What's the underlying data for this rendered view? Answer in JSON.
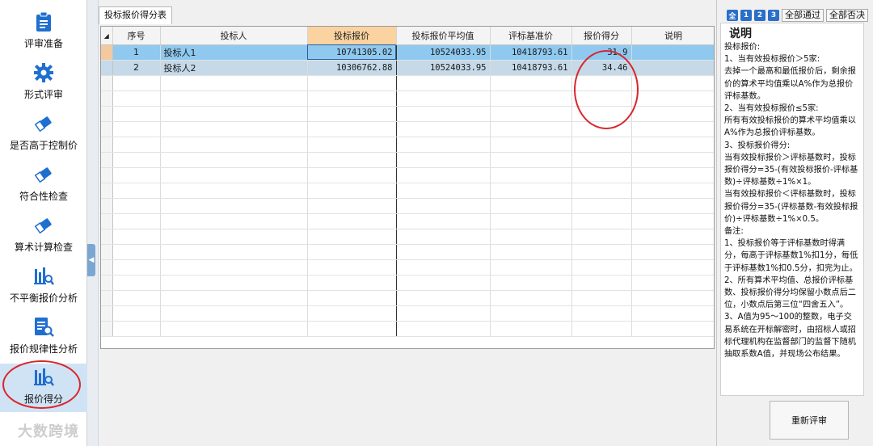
{
  "sidebar": {
    "items": [
      {
        "label": "评审准备",
        "icon": "clipboard-icon"
      },
      {
        "label": "形式评审",
        "icon": "gear-icon"
      },
      {
        "label": "是否高于控制价",
        "icon": "eraser-icon"
      },
      {
        "label": "符合性检查",
        "icon": "eraser-icon"
      },
      {
        "label": "算术计算检查",
        "icon": "eraser-icon"
      },
      {
        "label": "不平衡报价分析",
        "icon": "bar-chart-search-icon"
      },
      {
        "label": "报价规律性分析",
        "icon": "document-search-icon"
      },
      {
        "label": "报价得分",
        "icon": "bar-chart-search-icon",
        "active": true
      }
    ]
  },
  "main": {
    "tab_label": "投标报价得分表",
    "columns": [
      "序号",
      "投标人",
      "投标报价",
      "投标报价平均值",
      "评标基准价",
      "报价得分",
      "说明"
    ],
    "rows": [
      {
        "seq": "1",
        "bidder": "投标人1",
        "bid": "10741305.02",
        "avg": "10524033.95",
        "base": "10418793.61",
        "score": "31.9",
        "note": ""
      },
      {
        "seq": "2",
        "bidder": "投标人2",
        "bid": "10306762.88",
        "avg": "10524033.95",
        "base": "10418793.61",
        "score": "34.46",
        "note": ""
      }
    ]
  },
  "right_panel": {
    "step_buttons": [
      "全",
      "1",
      "2",
      "3"
    ],
    "pass_all": "全部通过",
    "reject_all": "全部否决",
    "title": "说明",
    "text": "投标报价:\n1、当有效投标报价＞5家:\n去掉一个最高和最低报价后，剩余报价的算术平均值乘以A%作为总报价评标基数。\n2、当有效投标报价≤5家:\n所有有效投标报价的算术平均值乘以A%作为总报价评标基数。\n3、投标报价得分:\n当有效投标报价＞评标基数时，投标报价得分=35-(有效投标报价-评标基数)÷评标基数÷1%×1。\n当有效投标报价＜评标基数时，投标报价得分=35-(评标基数-有效投标报价)÷评标基数÷1%×0.5。\n备注:\n1、投标报价等于评标基数时得满分，每高于评标基数1%扣1分，每低于评标基数1%扣0.5分，扣完为止。\n2、所有算术平均值、总报价评标基数、投标报价得分均保留小数点后二位，小数点后第三位“四舍五入”。\n3、A值为95～100的整数，电子交易系统在开标解密时，由招标人或招标代理机构在监督部门的监督下随机抽取系数A值，并现场公布结果。",
    "recalc_label": "重新评审"
  },
  "watermark": "大数跨境",
  "colors": {
    "accent": "#2a6fc9",
    "selected_row": "#8fc9ef",
    "alt_row": "#c5d9e8",
    "annotation": "#d9262c",
    "header_selected": "#fbd3a0"
  }
}
